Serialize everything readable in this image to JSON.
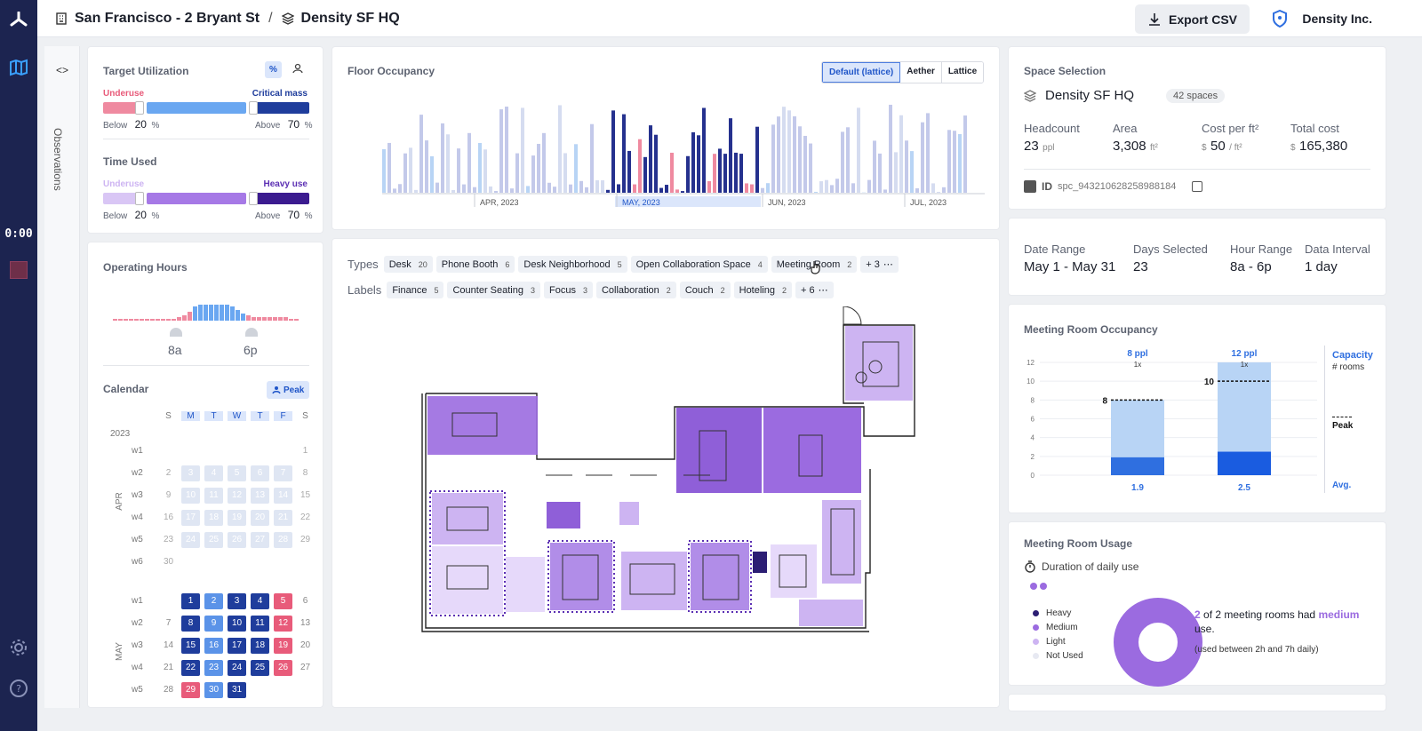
{
  "topbar": {
    "location": "San Francisco - 2 Bryant St",
    "separator": "/",
    "space": "Density SF HQ",
    "export_label": "Export CSV",
    "org_name": "Density Inc."
  },
  "rail": {
    "timer": "0:00"
  },
  "observations": {
    "label": "Observations",
    "toggle": "<>"
  },
  "target_utilization": {
    "title": "Target Utilization",
    "toggle_percent": "%",
    "underuse_label": "Underuse",
    "critical_label": "Critical mass",
    "below_label": "Below",
    "below_value": "20",
    "above_label": "Above",
    "above_value": "70",
    "unit": "%"
  },
  "time_used": {
    "title": "Time Used",
    "underuse_label": "Underuse",
    "heavy_label": "Heavy use",
    "below_label": "Below",
    "below_value": "20",
    "above_label": "Above",
    "above_value": "70",
    "unit": "%"
  },
  "operating_hours": {
    "title": "Operating Hours",
    "start": "8a",
    "end": "6p"
  },
  "calendar": {
    "title": "Calendar",
    "peak_label": "Peak",
    "weekdays": [
      "S",
      "M",
      "T",
      "W",
      "T",
      "F",
      "S"
    ],
    "year": "2023",
    "apr_label": "APR",
    "may_label": "MAY",
    "apr_weeks": [
      {
        "w": "w1",
        "days": [
          "",
          "",
          "",
          "",
          "",
          "",
          "1"
        ]
      },
      {
        "w": "w2",
        "days": [
          "2",
          "3",
          "4",
          "5",
          "6",
          "7",
          "8"
        ]
      },
      {
        "w": "w3",
        "days": [
          "9",
          "10",
          "11",
          "12",
          "13",
          "14",
          "15"
        ]
      },
      {
        "w": "w4",
        "days": [
          "16",
          "17",
          "18",
          "19",
          "20",
          "21",
          "22"
        ]
      },
      {
        "w": "w5",
        "days": [
          "23",
          "24",
          "25",
          "26",
          "27",
          "28",
          "29"
        ]
      },
      {
        "w": "w6",
        "days": [
          "30",
          "",
          "",
          "",
          "",
          "",
          ""
        ]
      }
    ],
    "may_weeks": [
      {
        "w": "w1",
        "days": [
          "",
          "1",
          "2",
          "3",
          "4",
          "5",
          "6"
        ]
      },
      {
        "w": "w2",
        "days": [
          "7",
          "8",
          "9",
          "10",
          "11",
          "12",
          "13"
        ]
      },
      {
        "w": "w3",
        "days": [
          "14",
          "15",
          "16",
          "17",
          "18",
          "19",
          "20"
        ]
      },
      {
        "w": "w4",
        "days": [
          "21",
          "22",
          "23",
          "24",
          "25",
          "26",
          "27"
        ]
      },
      {
        "w": "w5",
        "days": [
          "28",
          "29",
          "30",
          "31",
          "",
          "",
          ""
        ]
      }
    ]
  },
  "floor_occupancy": {
    "title": "Floor Occupancy",
    "modes": [
      "Default (lattice)",
      "Aether",
      "Lattice"
    ],
    "months": [
      "APR, 2023",
      "MAY, 2023",
      "JUN, 2023",
      "JUL, 2023"
    ]
  },
  "filters": {
    "types_label": "Types",
    "types": [
      {
        "label": "Desk",
        "count": "20"
      },
      {
        "label": "Phone Booth",
        "count": "6"
      },
      {
        "label": "Desk Neighborhood",
        "count": "5"
      },
      {
        "label": "Open Collaboration Space",
        "count": "4"
      },
      {
        "label": "Meeting Room",
        "count": "2"
      }
    ],
    "types_more": "+ 3",
    "labels_label": "Labels",
    "labels": [
      {
        "label": "Finance",
        "count": "5"
      },
      {
        "label": "Counter Seating",
        "count": "3"
      },
      {
        "label": "Focus",
        "count": "3"
      },
      {
        "label": "Collaboration",
        "count": "2"
      },
      {
        "label": "Couch",
        "count": "2"
      },
      {
        "label": "Hoteling",
        "count": "2"
      }
    ],
    "labels_more": "+ 6"
  },
  "space_selection": {
    "title": "Space Selection",
    "name": "Density SF HQ",
    "spaces": "42 spaces",
    "headcount_label": "Headcount",
    "headcount": "23",
    "headcount_unit": "ppl",
    "area_label": "Area",
    "area": "3,308",
    "area_unit": "ft²",
    "cost_label": "Cost per ft²",
    "cost_prefix": "$",
    "cost": "50",
    "cost_unit": "/ ft²",
    "total_label": "Total cost",
    "total_prefix": "$",
    "total": "165,380",
    "id_label": "ID",
    "id_value": "spc_943210628258988184"
  },
  "date_info": {
    "range_label": "Date Range",
    "range": "May 1 - May 31",
    "days_label": "Days Selected",
    "days": "23",
    "hours_label": "Hour Range",
    "hours": "8a - 6p",
    "interval_label": "Data Interval",
    "interval": "1 day"
  },
  "meeting_occupancy": {
    "title": "Meeting Room Occupancy",
    "capacity_label": "Capacity",
    "rooms_label": "# rooms",
    "peak_label": "Peak",
    "avg_label": "Avg."
  },
  "meeting_usage": {
    "title": "Meeting Room Usage",
    "subtitle": "Duration of daily use",
    "legend": [
      {
        "label": "Heavy",
        "color": "#2c1e73"
      },
      {
        "label": "Medium",
        "color": "#9b6be0"
      },
      {
        "label": "Light",
        "color": "#cdb4f2"
      },
      {
        "label": "Not Used",
        "color": "#e7e9f2"
      }
    ],
    "count": "2",
    "text_a": "of 2 meeting rooms had",
    "level": "medium",
    "text_b": "use.",
    "note": "(used between 2h and 7h daily)"
  },
  "chart_data": {
    "type": "bar",
    "title": "Meeting Room Occupancy",
    "categories": [
      "8 ppl",
      "12 ppl"
    ],
    "category_subtitles": [
      "1x",
      "1x"
    ],
    "series": [
      {
        "name": "Peak",
        "values": [
          8,
          10
        ]
      },
      {
        "name": "Avg.",
        "values": [
          1.9,
          2.5
        ]
      }
    ],
    "capacity": [
      8,
      12
    ],
    "ylim": [
      0,
      12
    ],
    "yticks": [
      0,
      2,
      4,
      6,
      8,
      10,
      12
    ],
    "grid": true
  },
  "colors": {
    "accent": "#2f6fe0",
    "underuse": "#e85b7a",
    "heavy": "#2c1e73",
    "medium": "#9b6be0",
    "rail": "#1c2450"
  }
}
